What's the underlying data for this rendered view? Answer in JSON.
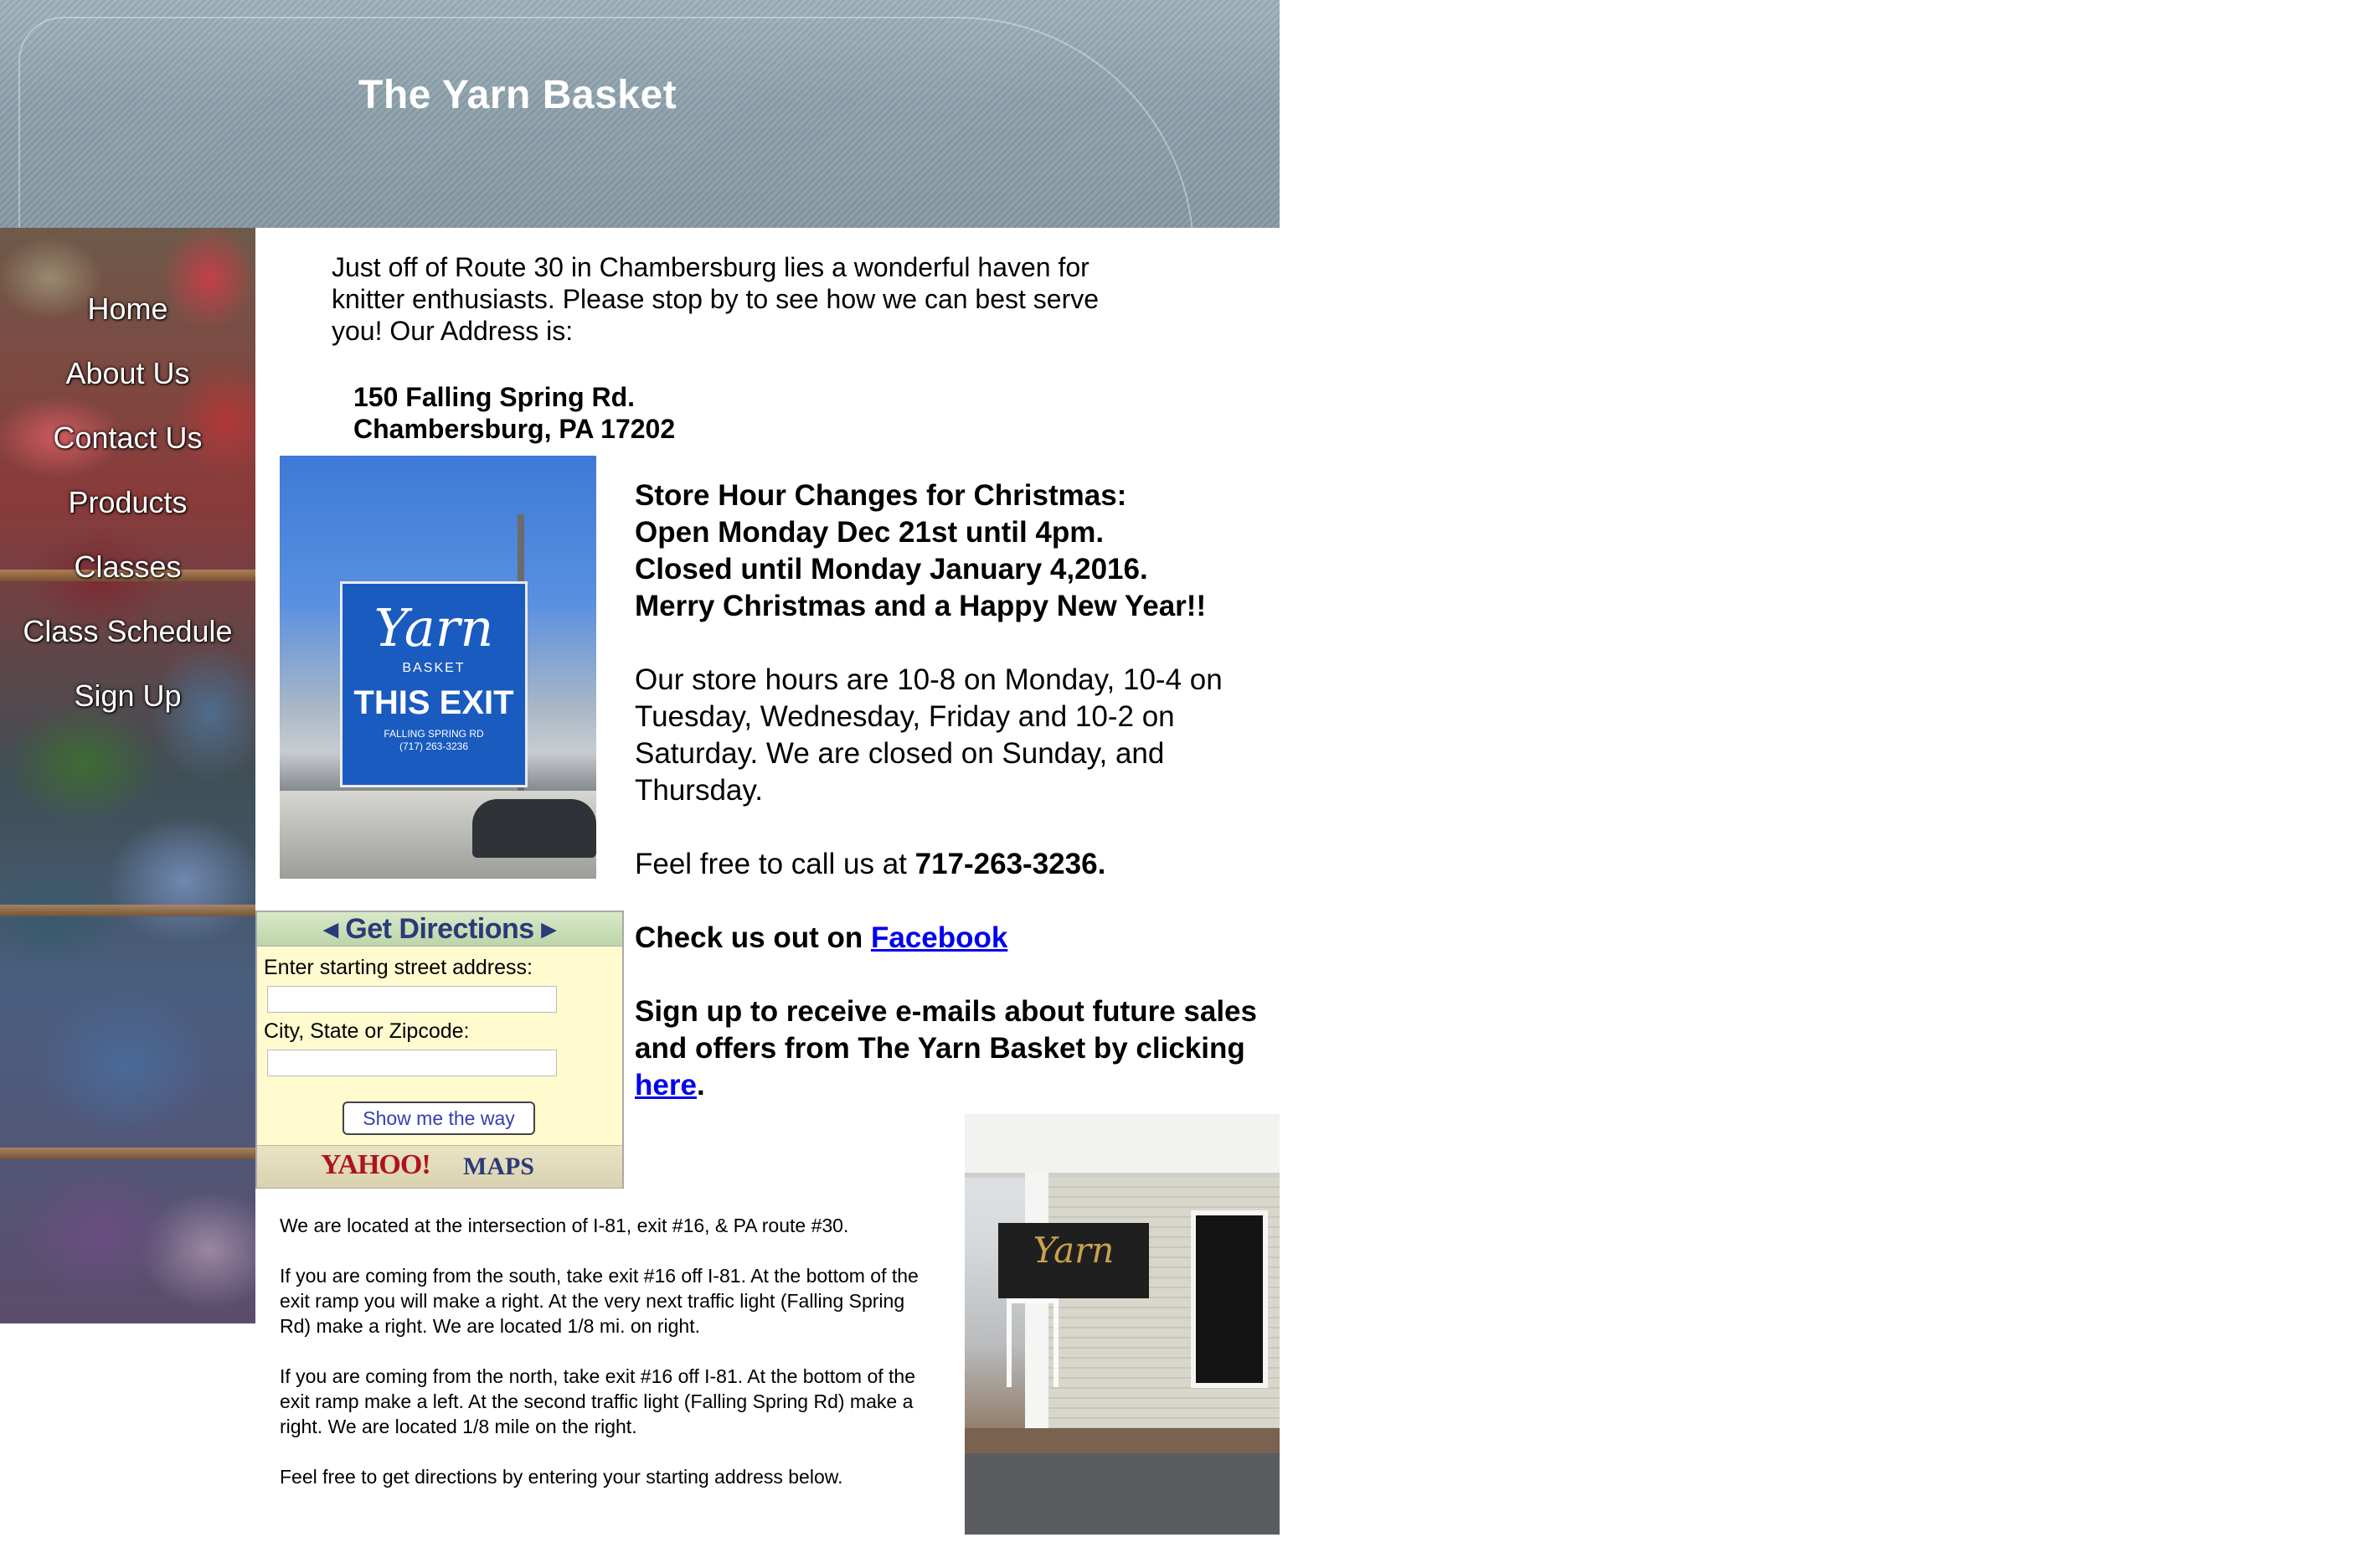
{
  "header": {
    "title": "The Yarn Basket"
  },
  "sidebar": {
    "items": [
      {
        "label": "Home"
      },
      {
        "label": "About Us"
      },
      {
        "label": "Contact Us"
      },
      {
        "label": "Products"
      },
      {
        "label": "Classes"
      },
      {
        "label": "Class Schedule"
      },
      {
        "label": "Sign Up"
      }
    ]
  },
  "intro": {
    "text": "Just off of Route 30 in Chambersburg lies a wonderful haven for knitter enthusiasts.  Please stop by to see how we can best serve you! Our Address is:",
    "address_line1": "150 Falling Spring Rd.",
    "address_line2": "Chambersburg, PA 17202"
  },
  "sign_photo": {
    "yarn": "Yarn",
    "basket": "BASKET",
    "exit": "THIS EXIT",
    "road": "FALLING SPRING RD",
    "phone": "(717) 263-3236"
  },
  "porch_photo": {
    "sign": "Yarn"
  },
  "announcement": {
    "line1": "Store Hour Changes for Christmas:",
    "line2": "Open Monday Dec 21st until 4pm.",
    "line3": "Closed until Monday January 4,2016.",
    "line4": "Merry Christmas and a Happy New Year!!"
  },
  "hours": "Our store hours are 10-8 on Monday, 10-4 on Tuesday, Wednesday,  Friday and 10-2 on Saturday.  We are closed on Sunday, and Thursday.",
  "call": {
    "prefix": "Feel free to call us at ",
    "phone": "717-263-3236."
  },
  "facebook": {
    "prefix": "Check us out on ",
    "link": "Facebook"
  },
  "signup": {
    "prefix": "Sign up to receive e-mails about future sales and offers from The Yarn Basket by clicking ",
    "link": "here",
    "suffix": "."
  },
  "directions_widget": {
    "title": "◂ Get Directions ▸",
    "street_label": "Enter starting street address:",
    "street_value": "",
    "city_label": "City, State or Zipcode:",
    "city_value": "",
    "button": "Show me the way",
    "footer_brand": "YAHOO!",
    "footer_maps": "MAPS"
  },
  "location": {
    "p1": "We are located at the intersection of I-81, exit #16, & PA route #30.",
    "p2": "If you are coming from the south, take exit #16 off I-81.  At the bottom of the exit ramp you will make a right. At the very next traffic light (Falling Spring Rd) make a right. We are located 1/8 mi. on right.",
    "p3": "If you are coming from the north, take exit #16 off I-81.  At the bottom of the exit ramp make a left.  At the second traffic light (Falling Spring Rd) make a right. We are located 1/8 mile on the right.",
    "p4": "Feel free to get directions by entering your starting address below."
  },
  "colors": {
    "link": "#0000ee",
    "header_bg": "#8da1ac",
    "widget_bg": "#fffbcf"
  }
}
